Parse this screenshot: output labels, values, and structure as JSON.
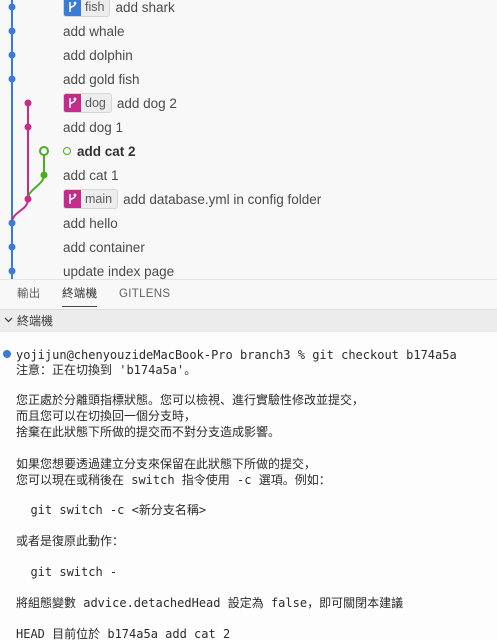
{
  "colors": {
    "main_branch": "#3a7bd5",
    "dog_branch": "#c62a8a",
    "cat_branch": "#4aaf1d",
    "terminal_dot": "#3a7bd5"
  },
  "commits": [
    {
      "message": "add shark",
      "branch": "fish",
      "lane": "main"
    },
    {
      "message": "add whale",
      "branch": "",
      "lane": "main"
    },
    {
      "message": "add dolphin",
      "branch": "",
      "lane": "main"
    },
    {
      "message": "add gold fish",
      "branch": "",
      "lane": "main"
    },
    {
      "message": "add dog 2",
      "branch": "dog",
      "lane": "dog"
    },
    {
      "message": "add dog 1",
      "branch": "",
      "lane": "dog"
    },
    {
      "message": "add cat 2",
      "branch": "",
      "lane": "cat",
      "is_head": true
    },
    {
      "message": "add cat 1",
      "branch": "",
      "lane": "cat"
    },
    {
      "message": "add database.yml in config folder",
      "branch": "main",
      "lane": "dog"
    },
    {
      "message": "add hello",
      "branch": "",
      "lane": "main"
    },
    {
      "message": "add container",
      "branch": "",
      "lane": "main"
    },
    {
      "message": "update index page",
      "branch": "",
      "lane": "main"
    }
  ],
  "panel_tabs": {
    "output": "輸出",
    "terminal": "終端機",
    "gitlens": "GITLENS"
  },
  "terminal": {
    "section_title": "終端機",
    "lines": [
      "yojijun@chenyouzideMacBook-Pro branch3 % git checkout b174a5a",
      "注意：正在切換到 'b174a5a'。",
      "",
      "您正處於分離頭指標狀態。您可以檢視、進行實驗性修改並提交，",
      "而且您可以在切換回一個分支時，",
      "捨棄在此狀態下所做的提交而不對分支造成影響。",
      "",
      "如果您想要透過建立分支來保留在此狀態下所做的提交，",
      "您可以現在或稍後在 switch 指令使用 -c 選項。例如：",
      "",
      "  git switch -c <新分支名稱>",
      "",
      "或者是復原此動作：",
      "",
      "  git switch -",
      "",
      "將組態變數 advice.detachedHead 設定為 false，即可關閉本建議",
      "",
      "HEAD 目前位於 b174a5a add cat 2"
    ]
  }
}
